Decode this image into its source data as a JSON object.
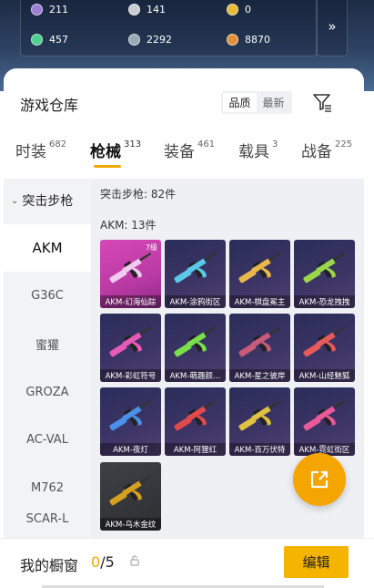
{
  "top_stats": [
    {
      "icon": "purple-crystal-icon",
      "value": "211",
      "color": "#9b7fd4"
    },
    {
      "icon": "silver-coin-icon",
      "value": "141",
      "color": "#c9ccd3"
    },
    {
      "icon": "gold-coin-icon",
      "value": "0",
      "color": "#e8b83a"
    },
    {
      "icon": "green-gem-icon",
      "value": "457",
      "color": "#4fcf91"
    },
    {
      "icon": "bp-coin-icon",
      "value": "2292",
      "color": "#9aa9b8"
    },
    {
      "icon": "uc-coin-icon",
      "value": "8870",
      "color": "#e0903a"
    }
  ],
  "expand_arrow": "»",
  "header": {
    "title": "游戏仓库",
    "sort_options": [
      "品质",
      "最新"
    ],
    "sort_selected": "品质"
  },
  "tabs": [
    {
      "label": "时装",
      "count": "682"
    },
    {
      "label": "枪械",
      "count": "313"
    },
    {
      "label": "装备",
      "count": "461"
    },
    {
      "label": "载具",
      "count": "3"
    },
    {
      "label": "战备",
      "count": "225"
    }
  ],
  "active_tab": "枪械",
  "sidebar": {
    "category": "突击步枪",
    "items": [
      "AKM",
      "G36C",
      "蜜獾",
      "GROZA",
      "AC-VAL",
      "M762",
      "SCAR-L"
    ],
    "selected": "AKM"
  },
  "content": {
    "category_count": "突击步枪: 82件",
    "group_count": "AKM: 13件",
    "items": [
      {
        "name": "AKM-幻海仙踪",
        "level": "7级",
        "style": "pink"
      },
      {
        "name": "AKM-涂鸦街区",
        "level": "",
        "style": "purple"
      },
      {
        "name": "AKM-棋盘冕主",
        "level": "",
        "style": "purple"
      },
      {
        "name": "AKM-恐龙拽拽",
        "level": "",
        "style": "purple"
      },
      {
        "name": "AKM-彩虹符号",
        "level": "",
        "style": "purple"
      },
      {
        "name": "AKM-萌趣颜…",
        "level": "",
        "style": "purple"
      },
      {
        "name": "AKM-星之彼岸",
        "level": "",
        "style": "purple"
      },
      {
        "name": "AKM-山经魅狐",
        "level": "",
        "style": "purple"
      },
      {
        "name": "AKM-夜灯",
        "level": "",
        "style": "purple"
      },
      {
        "name": "AKM-阿狸红",
        "level": "",
        "style": "purple"
      },
      {
        "name": "AKM-百万伏特",
        "level": "",
        "style": "purple"
      },
      {
        "name": "AKM-霓虹街区",
        "level": "",
        "style": "purple"
      },
      {
        "name": "AKM-乌木金纹",
        "level": "",
        "style": "dark"
      }
    ],
    "skin_colors": [
      "#f2c9ef",
      "#5bc8e8",
      "#e8b84a",
      "#9bd64a",
      "#e85ab8",
      "#7ae04a",
      "#c85a7a",
      "#e85a5a",
      "#4a90e8",
      "#e04a4a",
      "#e0c040",
      "#e85a9a",
      "#d4a020"
    ]
  },
  "fab_icon": "share-export-icon",
  "footer": {
    "title": "我的橱窗",
    "current": "0",
    "total": "/5",
    "edit_label": "编辑"
  },
  "colors": {
    "accent": "#f5b400",
    "tab_indicator": "#f0a800"
  }
}
